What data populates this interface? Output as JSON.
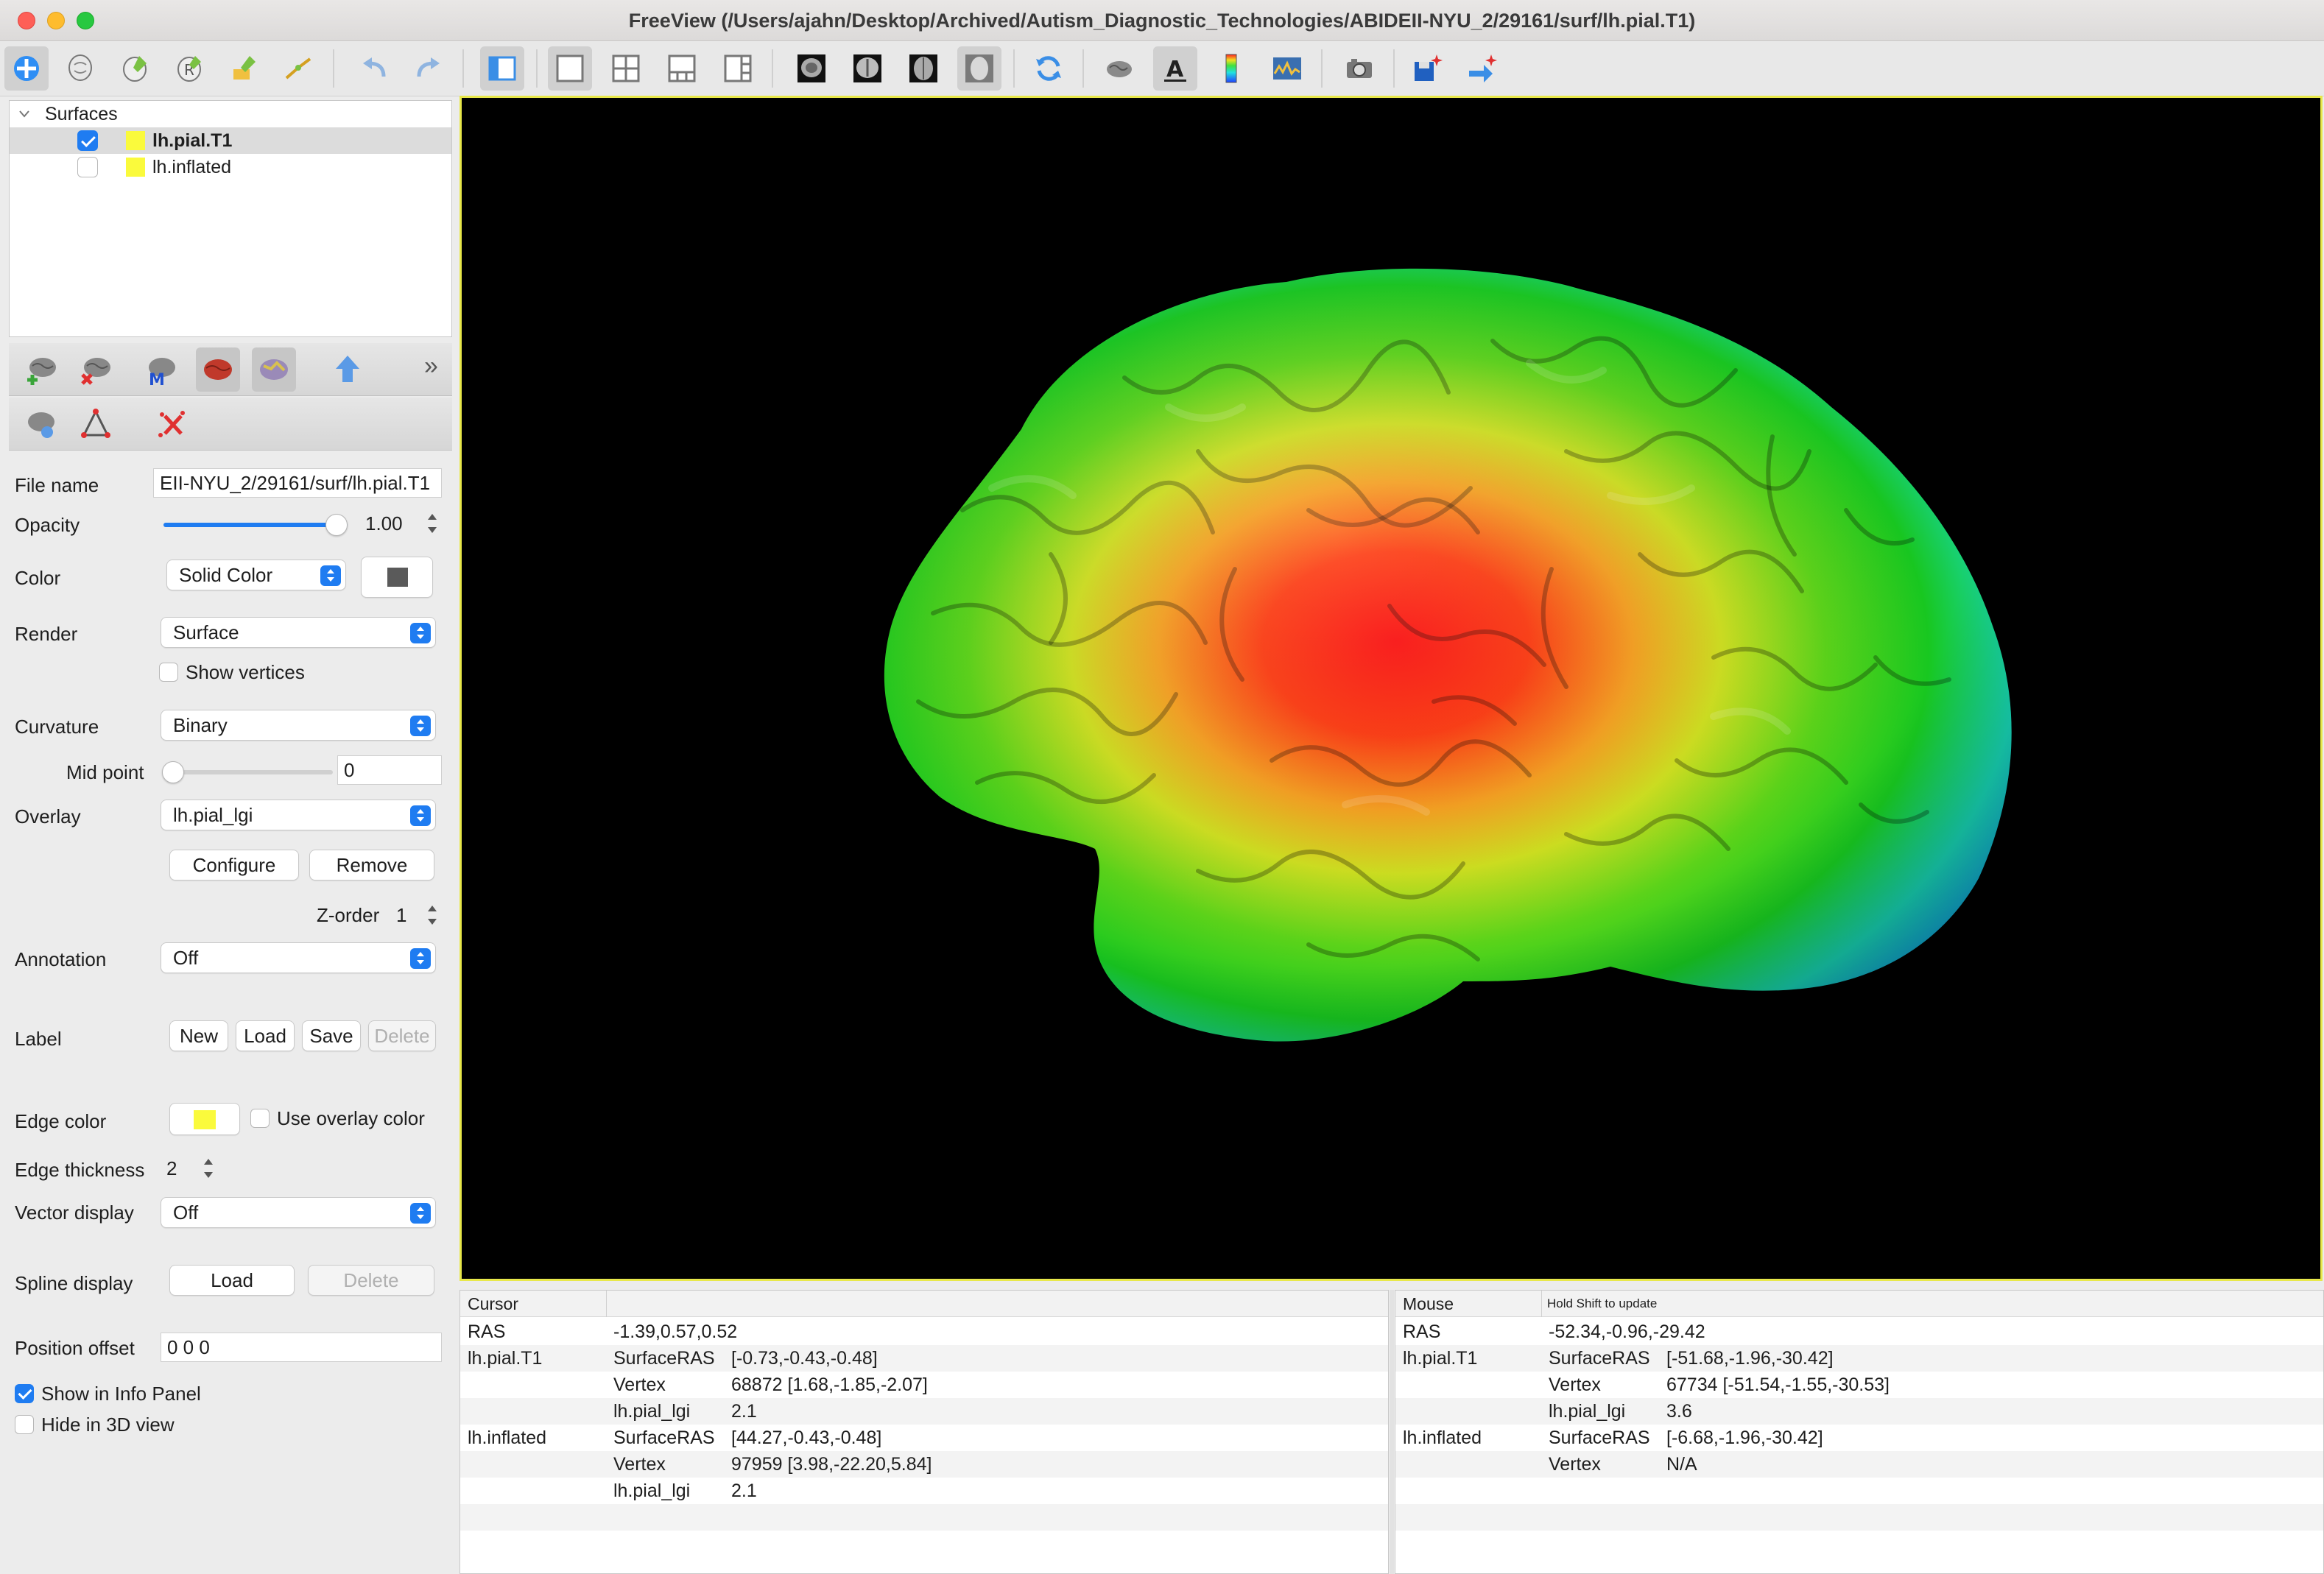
{
  "window": {
    "title": "FreeView (/Users/ajahn/Desktop/Archived/Autism_Diagnostic_Technologies/ABIDEII-NYU_2/29161/surf/lh.pial.T1)"
  },
  "toolbar": {
    "items": [
      "navigate-icon",
      "voxel-edit-icon",
      "recon-edit-icon",
      "roi-edit-icon",
      "point-set-edit-icon",
      "contour-icon",
      "undo-icon",
      "redo-icon",
      "toggle-panel-icon",
      "layout-1x1-icon",
      "layout-2x2-icon",
      "layout-1-3-icon",
      "layout-1-3-horizontal-icon",
      "sagittal-view-icon",
      "coronal-view-icon",
      "axial-view-icon",
      "3d-view-icon",
      "reset-view-icon",
      "show-surface-icon",
      "show-annotation-text-icon",
      "show-color-bar-icon",
      "show-histogram-icon",
      "screenshot-icon",
      "save-point-icon",
      "goto-point-icon"
    ]
  },
  "layers": {
    "group_label": "Surfaces",
    "items": [
      {
        "name": "lh.pial.T1",
        "checked": true,
        "selected": true,
        "color": "#fafa3c"
      },
      {
        "name": "lh.inflated",
        "checked": false,
        "selected": false,
        "color": "#fafa3c"
      }
    ]
  },
  "panel_toolbar": {
    "row1": [
      "load-surface-icon",
      "close-surface-icon",
      "load-surface-overlay-icon",
      "surface-color-icon",
      "surface-label-icon",
      "move-up-icon"
    ],
    "row2": [
      "load-patch-icon",
      "path-icon",
      "remove-points-icon"
    ],
    "more": "»"
  },
  "props": {
    "file_name_label": "File name",
    "file_name_value": "EII-NYU_2/29161/surf/lh.pial.T1",
    "opacity_label": "Opacity",
    "opacity_value": "1.00",
    "opacity_fraction": 1.0,
    "color_label": "Color",
    "color_mode": "Solid Color",
    "color_swatch": "#5a5a5a",
    "render_label": "Render",
    "render_value": "Surface",
    "show_vertices": "Show vertices",
    "curvature_label": "Curvature",
    "curvature_value": "Binary",
    "midpoint_label": "Mid point",
    "midpoint_value": "0",
    "overlay_label": "Overlay",
    "overlay_value": "lh.pial_lgi",
    "configure": "Configure",
    "remove": "Remove",
    "zorder_label": "Z-order",
    "zorder_value": "1",
    "annotation_label": "Annotation",
    "annotation_value": "Off",
    "label_label": "Label",
    "label_new": "New",
    "label_load": "Load",
    "label_save": "Save",
    "label_delete": "Delete",
    "edge_color_label": "Edge color",
    "edge_color": "#fafa3c",
    "use_overlay_color": "Use overlay color",
    "edge_thickness_label": "Edge thickness",
    "edge_thickness_value": "2",
    "vector_display_label": "Vector display",
    "vector_display_value": "Off",
    "spline_display_label": "Spline display",
    "spline_load": "Load",
    "spline_delete": "Delete",
    "position_offset_label": "Position offset",
    "position_offset_value": "0 0 0",
    "show_in_info_panel": "Show in Info Panel",
    "show_in_info_checked": true,
    "hide_in_3d": "Hide in 3D view",
    "hide_in_3d_checked": false
  },
  "cursor_info": {
    "header": "Cursor",
    "rows": [
      {
        "c1": "RAS",
        "c2": "-1.39,0.57,0.52",
        "c3": ""
      },
      {
        "c1": "lh.pial.T1",
        "c2": "SurfaceRAS",
        "c3": "[-0.73,-0.43,-0.48]"
      },
      {
        "c1": "",
        "c2": "Vertex",
        "c3": "68872  [1.68,-1.85,-2.07]"
      },
      {
        "c1": "",
        "c2": "lh.pial_lgi",
        "c3": "2.1"
      },
      {
        "c1": "lh.inflated",
        "c2": "SurfaceRAS",
        "c3": "[44.27,-0.43,-0.48]"
      },
      {
        "c1": "",
        "c2": "Vertex",
        "c3": "97959  [3.98,-22.20,5.84]"
      },
      {
        "c1": "",
        "c2": "lh.pial_lgi",
        "c3": "2.1"
      }
    ]
  },
  "mouse_info": {
    "header": "Mouse",
    "hint": "Hold Shift to update",
    "rows": [
      {
        "c1": "RAS",
        "c2": "-52.34,-0.96,-29.42",
        "c3": ""
      },
      {
        "c1": "lh.pial.T1",
        "c2": "SurfaceRAS",
        "c3": "[-51.68,-1.96,-30.42]"
      },
      {
        "c1": "",
        "c2": "Vertex",
        "c3": "67734  [-51.54,-1.55,-30.53]"
      },
      {
        "c1": "",
        "c2": "lh.pial_lgi",
        "c3": "3.6"
      },
      {
        "c1": "lh.inflated",
        "c2": "SurfaceRAS",
        "c3": "[-6.68,-1.96,-30.42]"
      },
      {
        "c1": "",
        "c2": "Vertex",
        "c3": "N/A"
      }
    ]
  },
  "viewport": {
    "background": "#000000",
    "border_color": "#e8e84a",
    "view": "3D"
  }
}
